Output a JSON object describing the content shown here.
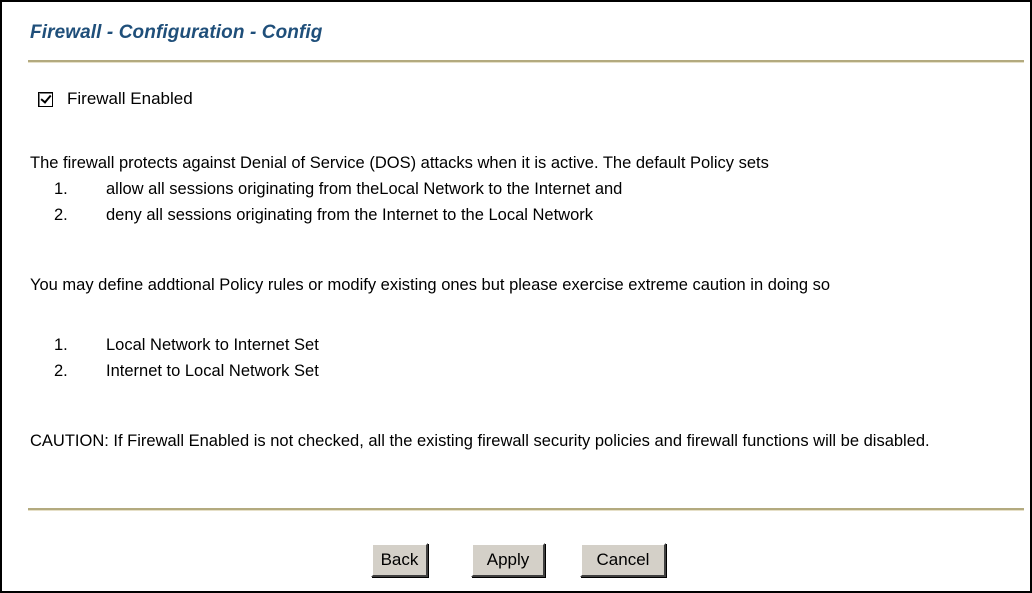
{
  "page": {
    "title": "Firewall - Configuration - Config"
  },
  "firewall_enabled": {
    "label": "Firewall Enabled",
    "checked": true
  },
  "policy_intro": {
    "text": "The firewall protects against Denial of Service (DOS) attacks when it is active. The default Policy sets",
    "items": [
      {
        "num": "1.",
        "text": "allow all sessions originating from theLocal Network to the Internet and"
      },
      {
        "num": "2.",
        "text": "deny all sessions originating from the Internet to the Local Network"
      }
    ]
  },
  "policy_rules": {
    "text": "You may define addtional Policy rules or modify existing ones but please exercise extreme caution in doing so",
    "items": [
      {
        "num": "1.",
        "text": "Local Network to Internet Set"
      },
      {
        "num": "2.",
        "text": "Internet to Local Network Set"
      }
    ]
  },
  "caution": {
    "text": "CAUTION: If Firewall Enabled is not checked, all the existing firewall security policies and firewall functions will be disabled."
  },
  "buttons": {
    "back": "Back",
    "apply": "Apply",
    "cancel": "Cancel"
  },
  "colors": {
    "title": "#1f4f7a",
    "rule": "#b3aa7f",
    "button_face": "#d4d0c8"
  }
}
